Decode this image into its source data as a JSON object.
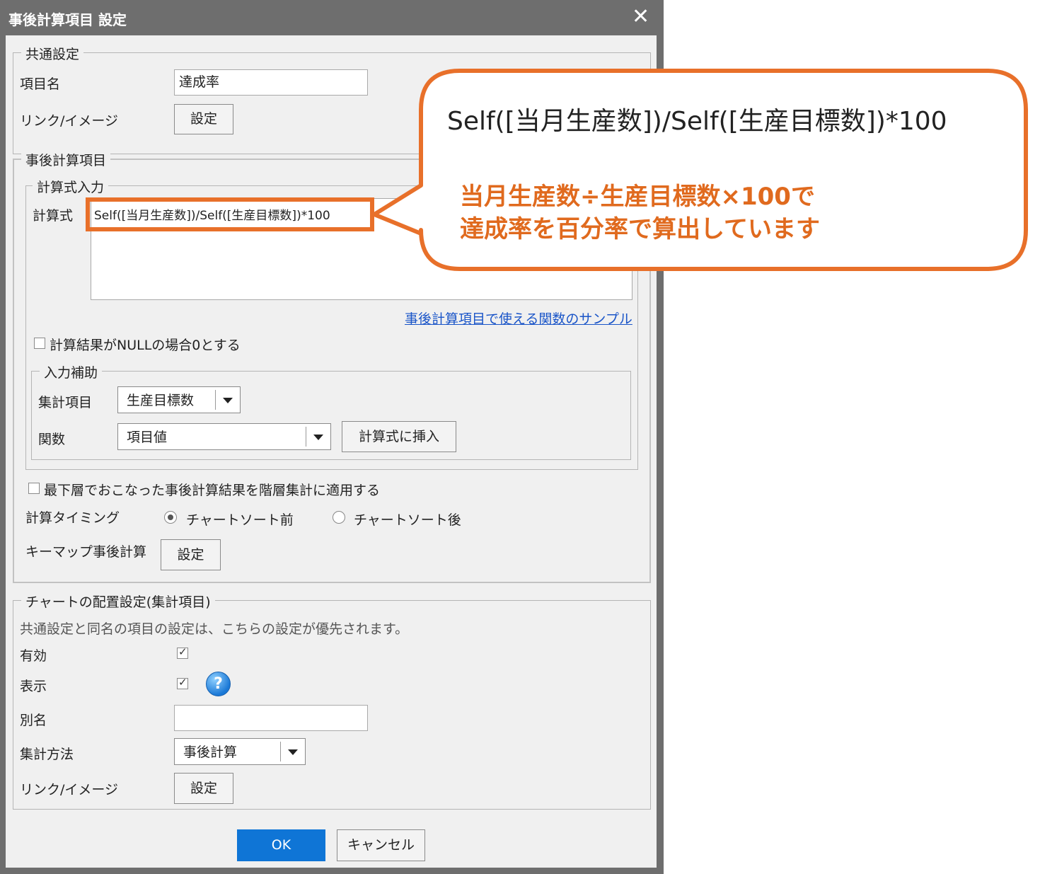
{
  "dialog": {
    "title": "事後計算項目 設定",
    "close_glyph": "✕"
  },
  "common": {
    "legend": "共通設定",
    "item_name_label": "項目名",
    "item_name_value": "達成率",
    "link_label": "リンク/イメージ",
    "link_button": "設定"
  },
  "calc": {
    "legend": "事後計算項目",
    "formula_legend": "計算式入力",
    "formula_label": "計算式",
    "formula_value": "Self([当月生産数])/Self([生産目標数])*100",
    "sample_link": "事後計算項目で使える関数のサンプル",
    "null_zero_label": "計算結果がNULLの場合0とする",
    "assist": {
      "legend": "入力補助",
      "agg_label": "集計項目",
      "agg_value": "生産目標数",
      "func_label": "関数",
      "func_value": "項目値",
      "insert_button": "計算式に挿入"
    },
    "apply_hierarchy_label": "最下層でおこなった事後計算結果を階層集計に適用する",
    "timing_label": "計算タイミング",
    "timing_before": "チャートソート前",
    "timing_after": "チャートソート後",
    "timing_selected": "before",
    "keymap_label": "キーマップ事後計算",
    "keymap_button": "設定"
  },
  "chart_layout": {
    "legend": "チャートの配置設定(集計項目)",
    "note": "共通設定と同名の項目の設定は、こちらの設定が優先されます。",
    "enabled_label": "有効",
    "enabled_checked": true,
    "show_label": "表示",
    "show_checked": true,
    "help_glyph": "?",
    "alias_label": "別名",
    "alias_value": "",
    "agg_method_label": "集計方法",
    "agg_method_value": "事後計算",
    "link_label": "リンク/イメージ",
    "link_button": "設定"
  },
  "footer": {
    "ok": "OK",
    "cancel": "キャンセル"
  },
  "callout": {
    "formula": "Self([当月生産数])/Self([生産目標数])*100",
    "note_line1": "当月生産数÷生産目標数×100で",
    "note_line2": "達成率を百分率で算出しています",
    "accent_color": "#e8702a"
  }
}
